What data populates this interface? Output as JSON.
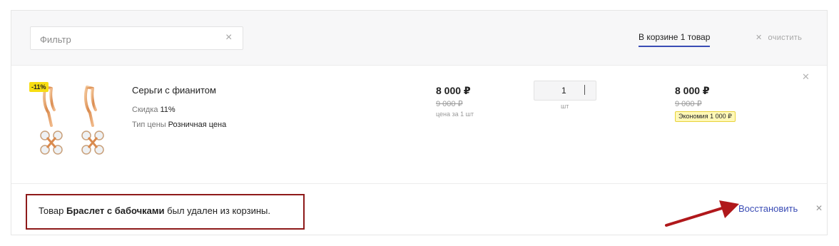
{
  "header": {
    "filter_placeholder": "Фильтр",
    "cart_count": "В корзине 1 товар",
    "clear_all": "очистить"
  },
  "item": {
    "discount_badge": "-11%",
    "name": "Серьги с фианитом",
    "discount_label": "Скидка",
    "discount_value": "11%",
    "price_type_label": "Тип цены",
    "price_type_value": "Розничная цена",
    "price": "8 000 ₽",
    "old_price": "9 000 ₽",
    "price_note": "цена за 1 шт",
    "quantity": "1",
    "unit": "шт",
    "total_price": "8 000 ₽",
    "total_old_price": "9 000 ₽",
    "savings": "Экономия 1 000 ₽"
  },
  "removed_notice": {
    "prefix": "Товар",
    "product": "Браслет с бабочками",
    "suffix": "был удален из корзины.",
    "restore_label": "Восстановить"
  },
  "colors": {
    "accent": "#3a4cb5",
    "badge": "#f7dd12",
    "highlight_border": "#8e1a1a"
  },
  "icons": {
    "filter_clear": "close-icon",
    "clear_all": "close-icon",
    "item_remove": "close-icon",
    "notice_close": "close-icon"
  }
}
